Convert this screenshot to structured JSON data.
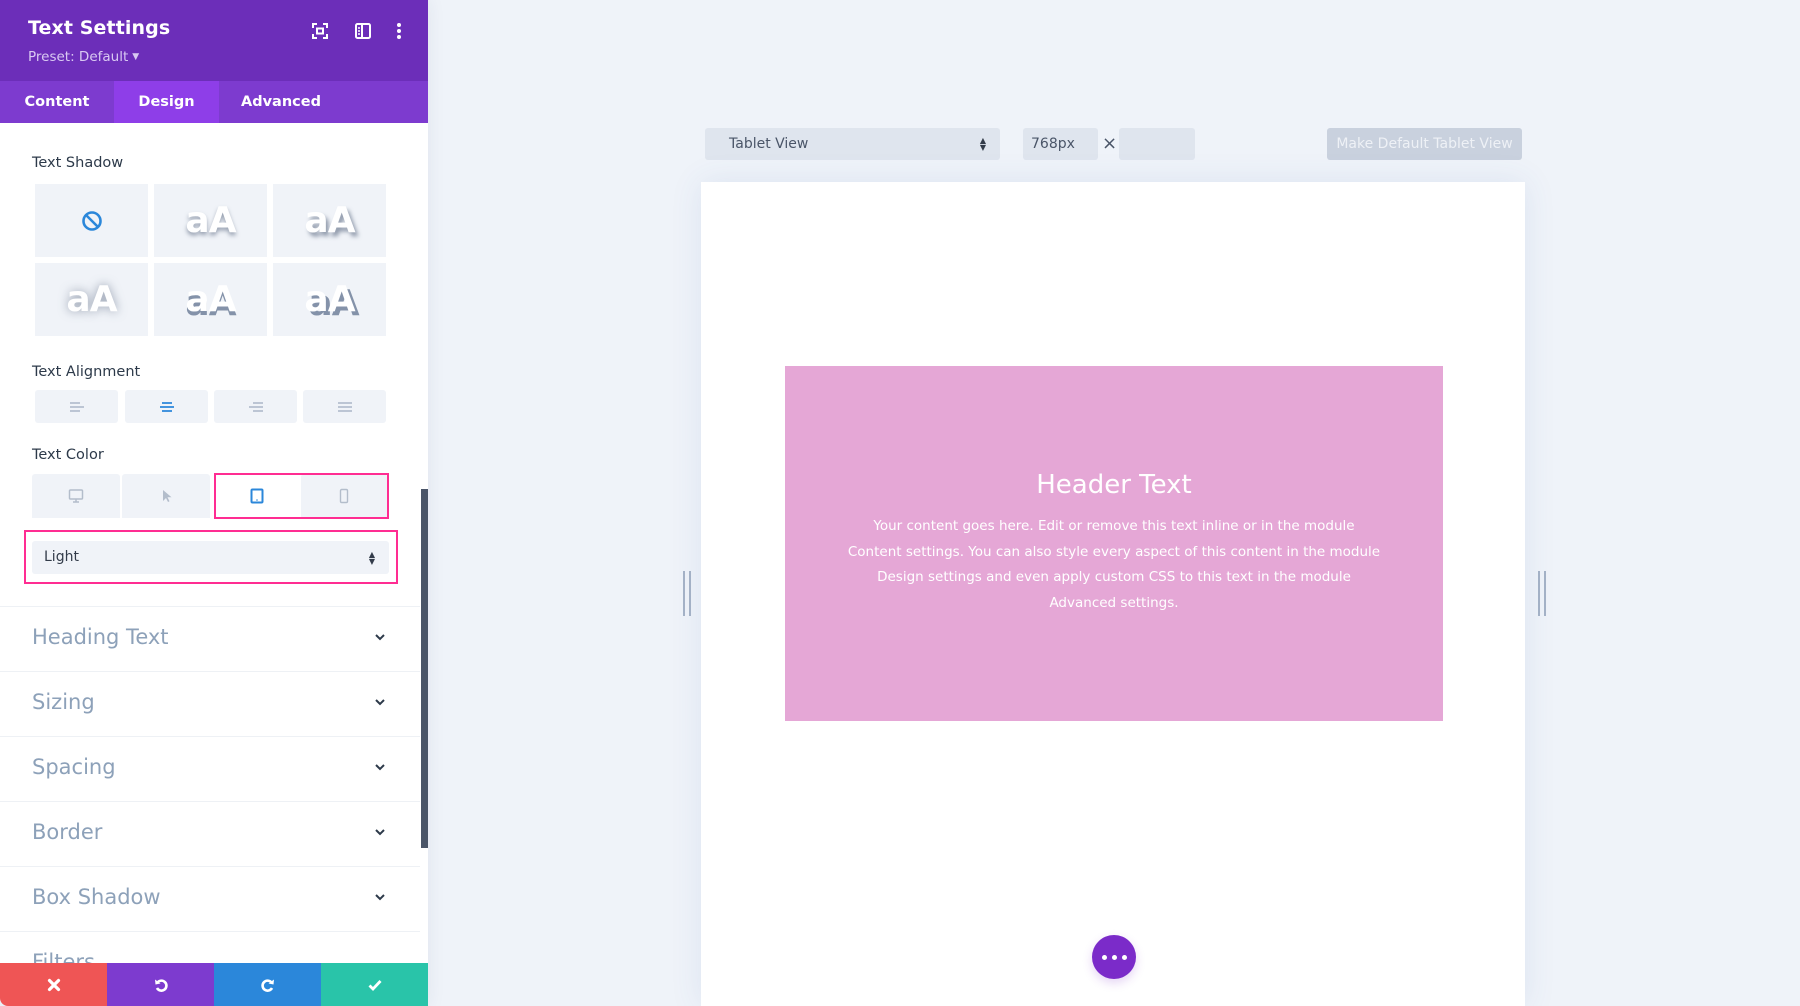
{
  "panel": {
    "title": "Text Settings",
    "preset_label": "Preset: Default",
    "header_icons": [
      "focus-mode-icon",
      "split-view-icon",
      "more-options-icon"
    ],
    "tabs": [
      {
        "label": "Content",
        "active": false
      },
      {
        "label": "Design",
        "active": true
      },
      {
        "label": "Advanced",
        "active": false
      }
    ],
    "text_shadow": {
      "label": "Text Shadow",
      "sample_text": "aA",
      "options": [
        "none",
        "preset-1",
        "preset-2",
        "preset-3",
        "preset-4",
        "preset-5"
      ],
      "selected": "none"
    },
    "text_alignment": {
      "label": "Text Alignment",
      "options": [
        "left",
        "center",
        "right",
        "justify"
      ],
      "selected": "center"
    },
    "text_color": {
      "label": "Text Color",
      "devices": [
        "desktop",
        "hover",
        "tablet",
        "phone"
      ],
      "active_device": "tablet",
      "value": "Light"
    },
    "accordions": [
      "Heading Text",
      "Sizing",
      "Spacing",
      "Border",
      "Box Shadow",
      "Filters"
    ],
    "bottom_bar": [
      "discard",
      "undo",
      "redo",
      "save"
    ]
  },
  "toolbar": {
    "view_select": "Tablet View",
    "width_value": "768px",
    "times": "×",
    "height_value": "",
    "make_default_label": "Make Default Tablet View"
  },
  "preview": {
    "header": "Header Text",
    "body": "Your content goes here. Edit or remove this text inline or in the module Content settings. You can also style every aspect of this content in the module Design settings and even apply custom CSS to this text in the module Advanced settings."
  },
  "colors": {
    "header_bg": "#6c2eb9",
    "tab_bar_bg": "#7d3bcf",
    "tab_active_bg": "#8e3ee8",
    "highlight": "#ff2d92",
    "accent_blue": "#2b87da",
    "module_bg": "#e5a7d6",
    "discard": "#ef5555",
    "undo": "#7d3bcf",
    "redo": "#2b87da",
    "save": "#29c4a9"
  }
}
